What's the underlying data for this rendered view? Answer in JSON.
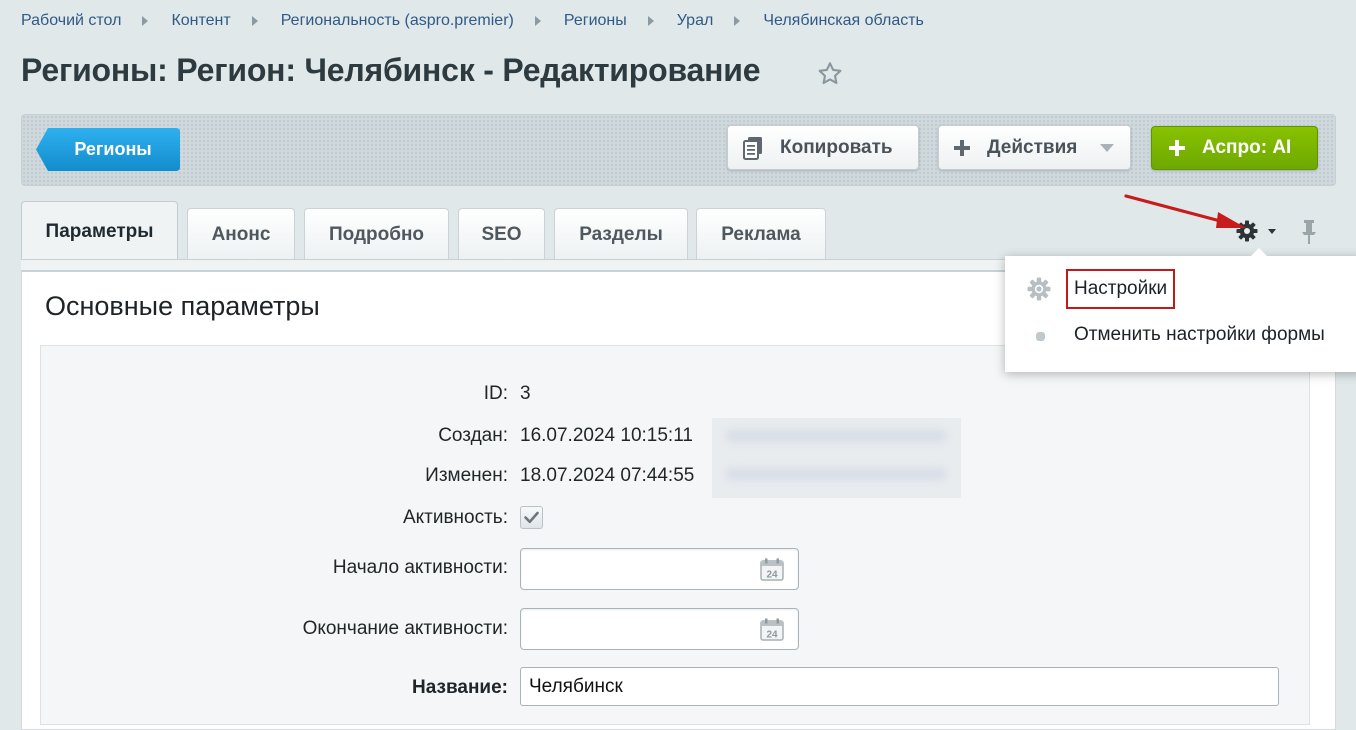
{
  "breadcrumb": [
    "Рабочий стол",
    "Контент",
    "Региональность (aspro.premier)",
    "Регионы",
    "Урал",
    "Челябинская область"
  ],
  "page": {
    "title": "Регионы: Регион: Челябинск - Редактирование"
  },
  "toolbar": {
    "back_label": "Регионы",
    "copy_label": "Копировать",
    "actions_label": "Действия",
    "ai_label": "Аспро: AI"
  },
  "tabs": [
    "Параметры",
    "Анонс",
    "Подробно",
    "SEO",
    "Разделы",
    "Реклама"
  ],
  "active_tab": "Параметры",
  "section": {
    "title": "Основные параметры"
  },
  "form": {
    "id_label": "ID:",
    "id_value": "3",
    "created_label": "Создан:",
    "created_value": "16.07.2024 10:15:11",
    "modified_label": "Изменен:",
    "modified_value": "18.07.2024 07:44:55",
    "active_label": "Активность:",
    "active_checked": true,
    "start_label": "Начало активности:",
    "start_value": "",
    "end_label": "Окончание активности:",
    "end_value": "",
    "name_label": "Название:",
    "name_value": "Челябинск"
  },
  "calendar_icon_text": "24",
  "settings_menu": {
    "items": [
      "Настройки",
      "Отменить настройки формы"
    ]
  },
  "colors": {
    "accent_blue": "#1a98d7",
    "ai_green": "#78b400",
    "highlight_red": "#c21a1a"
  }
}
